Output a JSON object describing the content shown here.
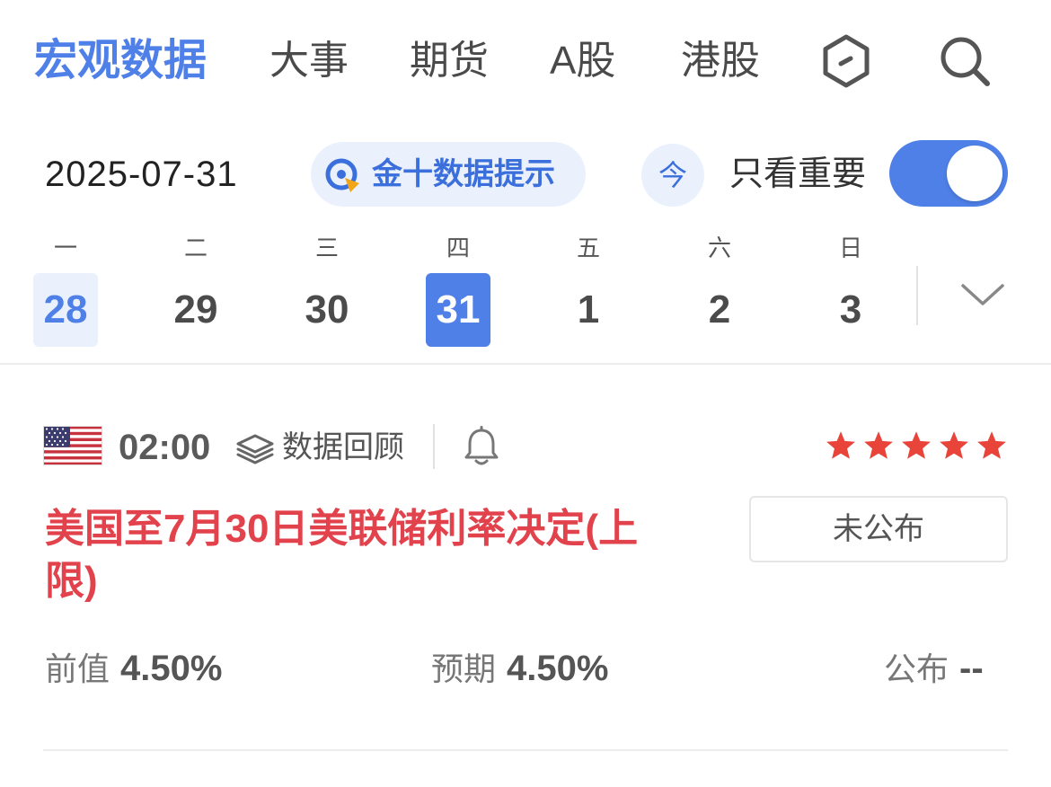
{
  "nav": {
    "tabs": [
      {
        "label": "宏观数据",
        "active": true
      },
      {
        "label": "大事",
        "active": false
      },
      {
        "label": "期货",
        "active": false
      },
      {
        "label": "A股",
        "active": false
      },
      {
        "label": "港股",
        "active": false
      }
    ],
    "icons": [
      "hexagon-icon",
      "search-icon"
    ]
  },
  "date_bar": {
    "date": "2025-07-31",
    "tips_label": "金十数据提示",
    "today_label": "今",
    "only_important_label": "只看重要",
    "only_important_on": true
  },
  "week": {
    "days": [
      {
        "weekday": "一",
        "date": "28",
        "state": "today"
      },
      {
        "weekday": "二",
        "date": "29",
        "state": "normal"
      },
      {
        "weekday": "三",
        "date": "30",
        "state": "normal"
      },
      {
        "weekday": "四",
        "date": "31",
        "state": "selected"
      },
      {
        "weekday": "五",
        "date": "1",
        "state": "normal"
      },
      {
        "weekday": "六",
        "date": "2",
        "state": "normal"
      },
      {
        "weekday": "日",
        "date": "3",
        "state": "normal"
      }
    ]
  },
  "event": {
    "country_flag": "us-flag-icon",
    "time": "02:00",
    "review_label": "数据回顾",
    "importance_stars": 5,
    "title": "美国至7月30日美联储利率决定(上限)",
    "status_label": "未公布",
    "previous_label": "前值",
    "previous_value": "4.50%",
    "expected_label": "预期",
    "expected_value": "4.50%",
    "actual_label": "公布",
    "actual_value": "--"
  },
  "colors": {
    "accent": "#4f80e8",
    "accent_light": "#eaf1fd",
    "title_red": "#e2424b",
    "star_red": "#e8443a"
  }
}
